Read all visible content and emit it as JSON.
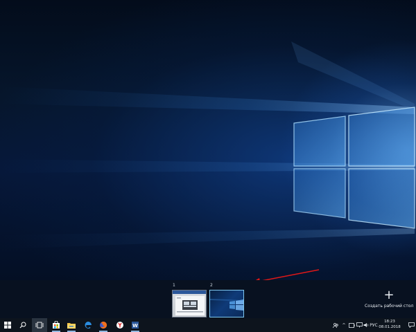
{
  "desktops": [
    {
      "number": "1",
      "active": false
    },
    {
      "number": "2",
      "active": true
    }
  ],
  "new_desktop": {
    "icon": "plus-icon",
    "label": "Создать рабочий стол"
  },
  "taskbar": {
    "pinned": [
      {
        "icon": "file-explorer-icon"
      },
      {
        "icon": "edge-icon"
      },
      {
        "icon": "firefox-icon"
      },
      {
        "icon": "yandex-browser-icon"
      },
      {
        "icon": "word-icon"
      }
    ]
  },
  "tray": {
    "language": "РУС",
    "time": "18:23",
    "date": "08.01.2018"
  },
  "colors": {
    "accent": "#7fc8f0",
    "taskbar": "#0d141d",
    "arrow": "#e01818"
  }
}
